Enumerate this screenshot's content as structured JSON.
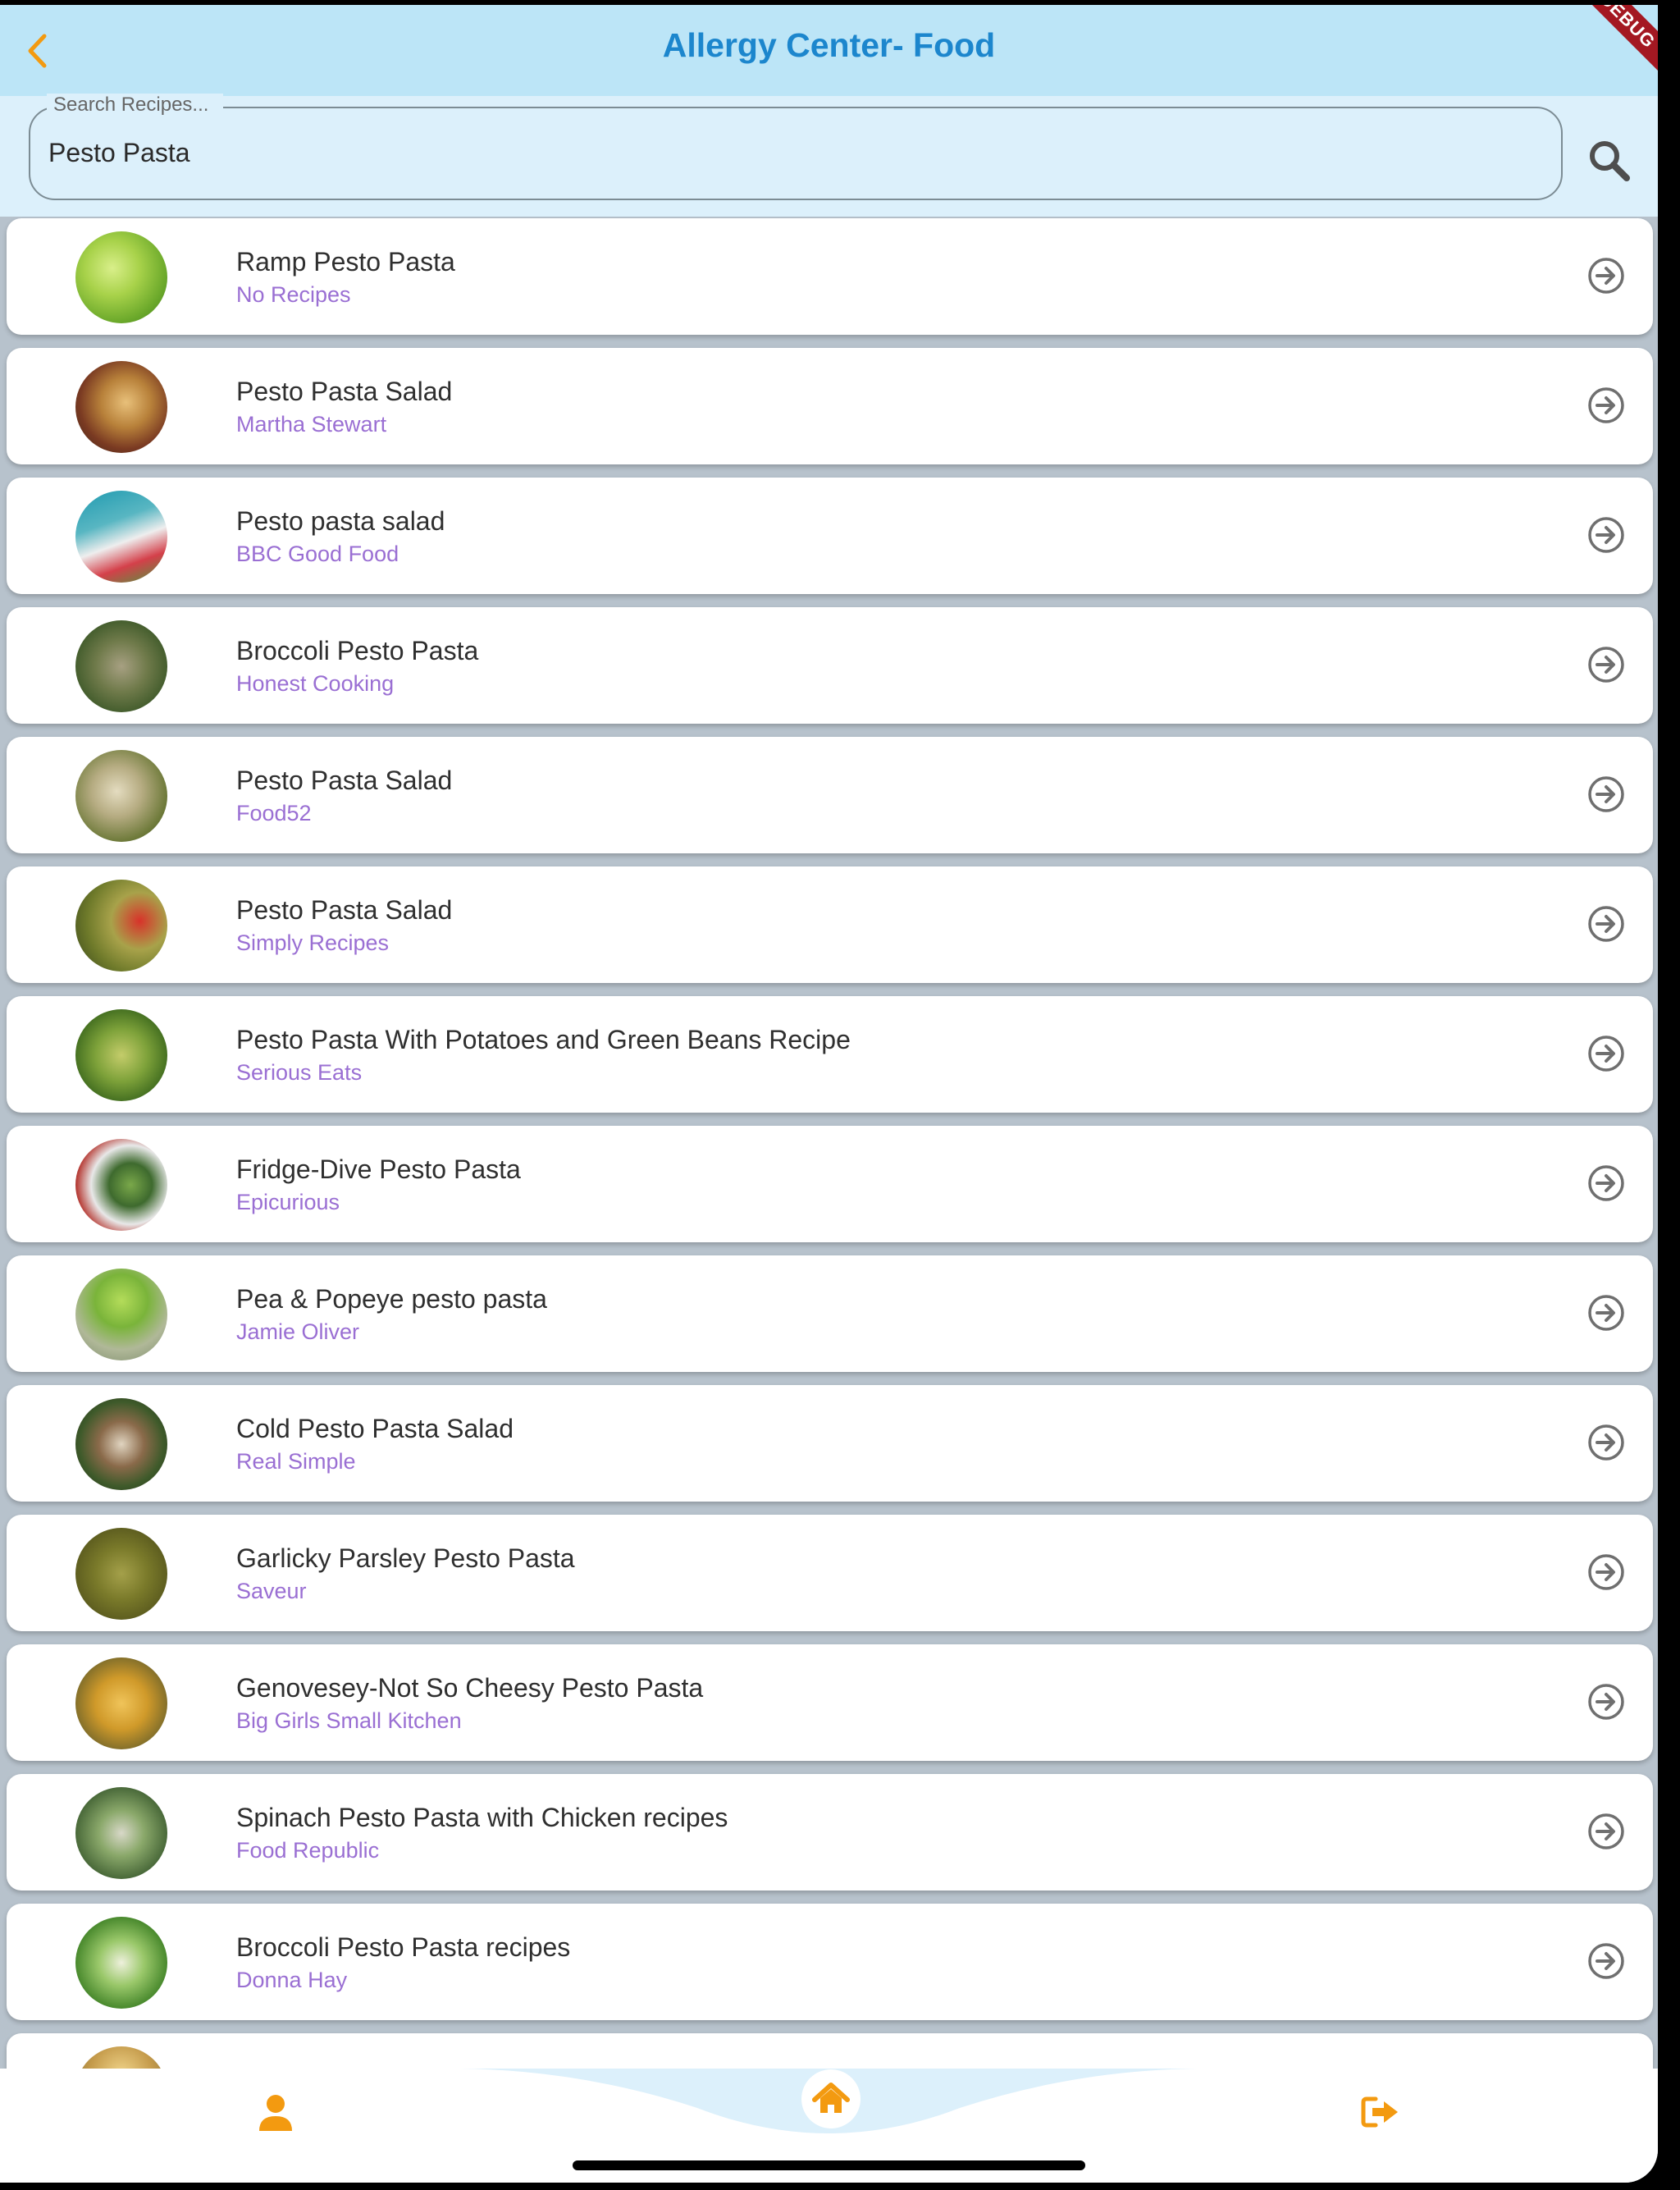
{
  "header": {
    "title": "Allergy Center- Food",
    "debug_banner": "DEBUG"
  },
  "search": {
    "label": "Search Recipes...",
    "value": "Pesto Pasta"
  },
  "recipes": [
    {
      "title": "Ramp Pesto Pasta",
      "source": "No Recipes"
    },
    {
      "title": "Pesto Pasta Salad",
      "source": "Martha Stewart"
    },
    {
      "title": "Pesto pasta salad",
      "source": "BBC Good Food"
    },
    {
      "title": "Broccoli Pesto Pasta",
      "source": "Honest Cooking"
    },
    {
      "title": "Pesto Pasta Salad",
      "source": "Food52"
    },
    {
      "title": "Pesto Pasta Salad",
      "source": "Simply Recipes"
    },
    {
      "title": "Pesto Pasta With Potatoes and Green Beans Recipe",
      "source": "Serious Eats"
    },
    {
      "title": "Fridge-Dive Pesto Pasta",
      "source": "Epicurious"
    },
    {
      "title": "Pea & Popeye pesto pasta",
      "source": "Jamie Oliver"
    },
    {
      "title": "Cold Pesto Pasta Salad",
      "source": "Real Simple"
    },
    {
      "title": "Garlicky Parsley Pesto Pasta",
      "source": "Saveur"
    },
    {
      "title": "Genovesey-Not So Cheesy Pesto Pasta",
      "source": "Big Girls Small Kitchen"
    },
    {
      "title": "Spinach Pesto Pasta with Chicken recipes",
      "source": "Food Republic"
    },
    {
      "title": "Broccoli Pesto Pasta recipes",
      "source": "Donna Hay"
    },
    {
      "title": "",
      "source": ""
    }
  ],
  "icons": {
    "back": "chevron-left-icon",
    "search": "search-icon",
    "row_action": "arrow-circle-right-icon",
    "nav_profile": "person-icon",
    "nav_home": "home-icon",
    "nav_logout": "logout-icon"
  },
  "colors": {
    "appbar_bg": "#bce5f7",
    "title": "#1c86cd",
    "accent_orange": "#f39a10",
    "source_purple": "#9a6fd3",
    "search_bg": "#dcf0fb"
  }
}
